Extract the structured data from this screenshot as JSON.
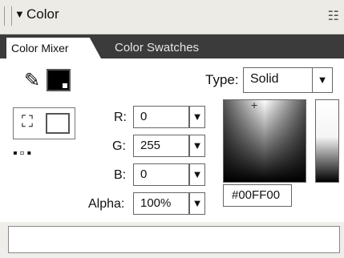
{
  "panel": {
    "title": "Color",
    "collapse_icon": "▼",
    "options_icon": "☷"
  },
  "tabs": [
    {
      "label": "Color Mixer",
      "active": true
    },
    {
      "label": "Color Swatches",
      "active": false
    }
  ],
  "type": {
    "label": "Type:",
    "value": "Solid",
    "arrow": "▼"
  },
  "rgb": {
    "r_label": "R:",
    "r_value": "0",
    "g_label": "G:",
    "g_value": "255",
    "b_label": "B:",
    "b_value": "0",
    "alpha_label": "Alpha:",
    "alpha_value": "100%"
  },
  "hex_value": "#00FF00",
  "icons": {
    "pencil": "✎",
    "bucket": "⛶",
    "small_icons": "▪▫▪"
  },
  "colors": {
    "stroke_swatch": "#000000",
    "fill_swatch": "#ffffff",
    "tab_bar": "#3b3b3b"
  }
}
